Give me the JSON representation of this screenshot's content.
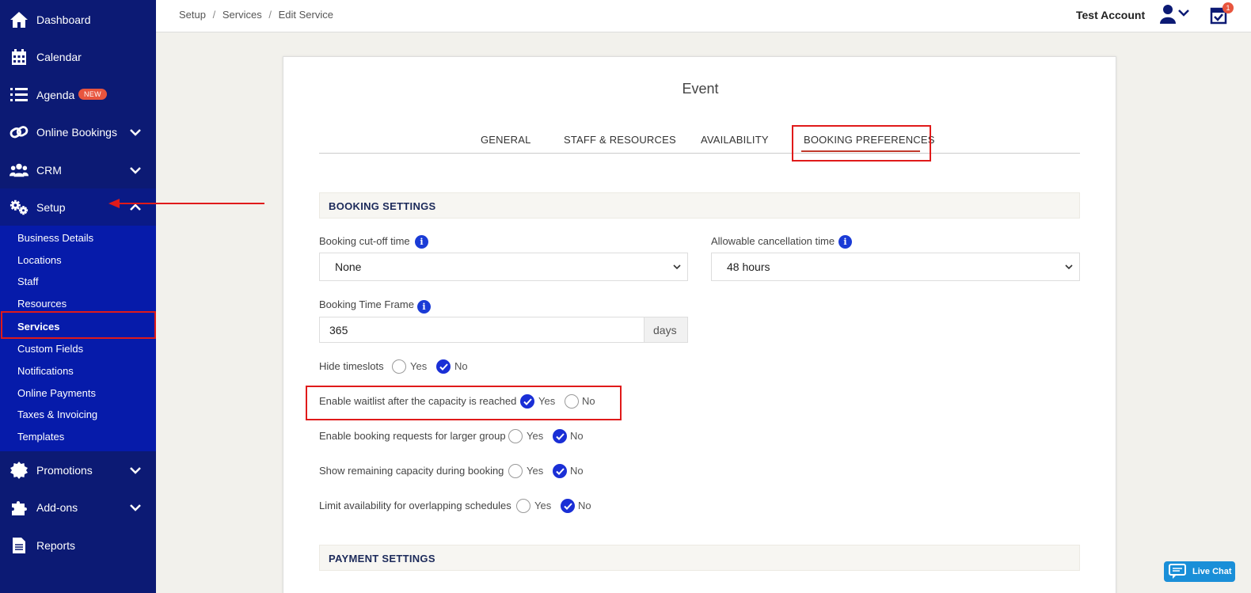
{
  "sidebar": {
    "items": [
      {
        "label": "Dashboard",
        "icon": "home-icon"
      },
      {
        "label": "Calendar",
        "icon": "calendar-icon"
      },
      {
        "label": "Agenda",
        "icon": "list-icon",
        "badge": "NEW"
      },
      {
        "label": "Online Bookings",
        "icon": "link-icon"
      },
      {
        "label": "CRM",
        "icon": "users-icon"
      },
      {
        "label": "Setup",
        "icon": "gears-icon"
      },
      {
        "label": "Promotions",
        "icon": "badge-icon"
      },
      {
        "label": "Add-ons",
        "icon": "puzzle-icon"
      },
      {
        "label": "Reports",
        "icon": "document-icon"
      }
    ],
    "setup_sub": [
      "Business Details",
      "Locations",
      "Staff",
      "Resources",
      "Services",
      "Custom Fields",
      "Notifications",
      "Online Payments",
      "Taxes & Invoicing",
      "Templates"
    ]
  },
  "header": {
    "breadcrumb": [
      "Setup",
      "Services",
      "Edit Service"
    ],
    "separator": "/",
    "account": "Test Account",
    "notification_count": "1"
  },
  "card": {
    "title": "Event",
    "tabs": [
      "GENERAL",
      "STAFF & RESOURCES",
      "AVAILABILITY",
      "BOOKING PREFERENCES"
    ],
    "booking_settings": {
      "heading": "BOOKING SETTINGS",
      "cutoff_label": "Booking cut-off time",
      "cutoff_value": "None",
      "cancel_label": "Allowable cancellation time",
      "cancel_value": "48 hours",
      "timeframe_label": "Booking Time Frame",
      "timeframe_value": "365",
      "timeframe_unit": "days",
      "options": [
        {
          "label": "Hide timeslots",
          "yes": "Yes",
          "no": "No",
          "selected": "No"
        },
        {
          "label": "Enable waitlist after the capacity is reached",
          "yes": "Yes",
          "no": "No",
          "selected": "Yes"
        },
        {
          "label": "Enable booking requests for larger group",
          "yes": "Yes",
          "no": "No",
          "selected": "No"
        },
        {
          "label": "Show remaining capacity during booking",
          "yes": "Yes",
          "no": "No",
          "selected": "No"
        },
        {
          "label": "Limit availability for overlapping schedules",
          "yes": "Yes",
          "no": "No",
          "selected": "No"
        }
      ]
    },
    "payment_settings": {
      "heading": "PAYMENT SETTINGS"
    }
  },
  "livechat": {
    "label": "Live Chat"
  },
  "colors": {
    "sidebar": "#0c1a74",
    "submenu": "#061baa",
    "accent": "#1a2fd6",
    "highlight": "#e01a1a",
    "badge": "#e8553e"
  }
}
